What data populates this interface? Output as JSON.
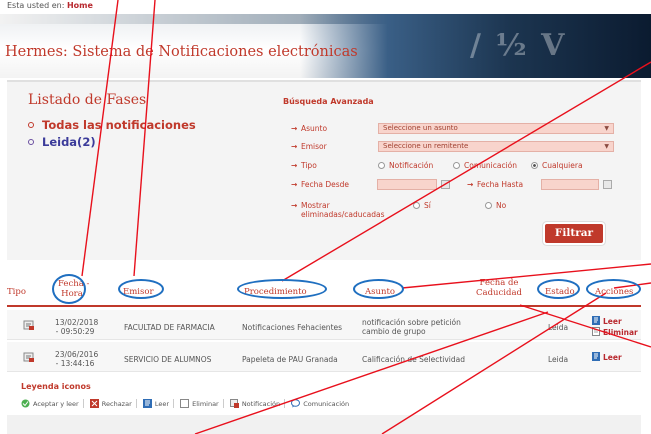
{
  "breadcrumb": {
    "prefix": "Esta usted en:",
    "current": "Home"
  },
  "app": {
    "title": "Hermes: Sistema de Notificaciones electrónicas"
  },
  "listado": {
    "title": "Listado de Fases",
    "items": [
      {
        "label": "Todas las notificaciones",
        "active": true
      },
      {
        "label": "Leida(2)",
        "active": false
      }
    ]
  },
  "busqueda": {
    "title": "Búsqueda Avanzada",
    "asunto_label": "Asunto",
    "asunto_value": "Seleccione un asunto",
    "emisor_label": "Emisor",
    "emisor_value": "Seleccione un remitente",
    "tipo_label": "Tipo",
    "tipo_options": [
      "Notificación",
      "Comunicación",
      "Cualquiera"
    ],
    "tipo_selected": "Cualquiera",
    "fecha_desde_label": "Fecha Desde",
    "fecha_hasta_label": "Fecha Hasta",
    "mostrar_label_1": "Mostrar",
    "mostrar_label_2": "eliminadas/caducadas",
    "mostrar_options": [
      "Sí",
      "No"
    ],
    "filtrar_label": "Filtrar"
  },
  "table": {
    "headers": {
      "tipo": "Tipo",
      "fecha_1": "Fecha -",
      "fecha_2": "Hora",
      "emisor": "Emisor",
      "procedimiento": "Procedimiento",
      "asunto": "Asunto",
      "caducidad_1": "Fecha de",
      "caducidad_2": "Caducidad",
      "estado": "Estado",
      "acciones": "Acciones"
    },
    "rows": [
      {
        "fecha_1": "13/02/2018",
        "fecha_2": "- 09:50:29",
        "emisor": "FACULTAD DE FARMACIA",
        "procedimiento": "Notificaciones Fehacientes",
        "asunto_1": "notificación sobre petición",
        "asunto_2": "cambio de grupo",
        "estado": "Leida",
        "accion_1": "Leer",
        "accion_2": "Eliminar"
      },
      {
        "fecha_1": "23/06/2016",
        "fecha_2": "- 13:44:16",
        "emisor": "SERVICIO DE ALUMNOS",
        "procedimiento": "Papeleta de PAU Granada",
        "asunto_1": "Calificación de Selectividad",
        "estado": "Leida",
        "accion_1": "Leer"
      }
    ]
  },
  "leyenda": {
    "title": "Leyenda iconos",
    "items": [
      "Aceptar y leer",
      "Rechazar",
      "Leer",
      "Eliminar",
      "Notificación",
      "Comunicación"
    ]
  },
  "colors": {
    "accent": "#c0392b",
    "annotation_oval": "#1f6fc0",
    "annotation_line": "#e8101c"
  }
}
